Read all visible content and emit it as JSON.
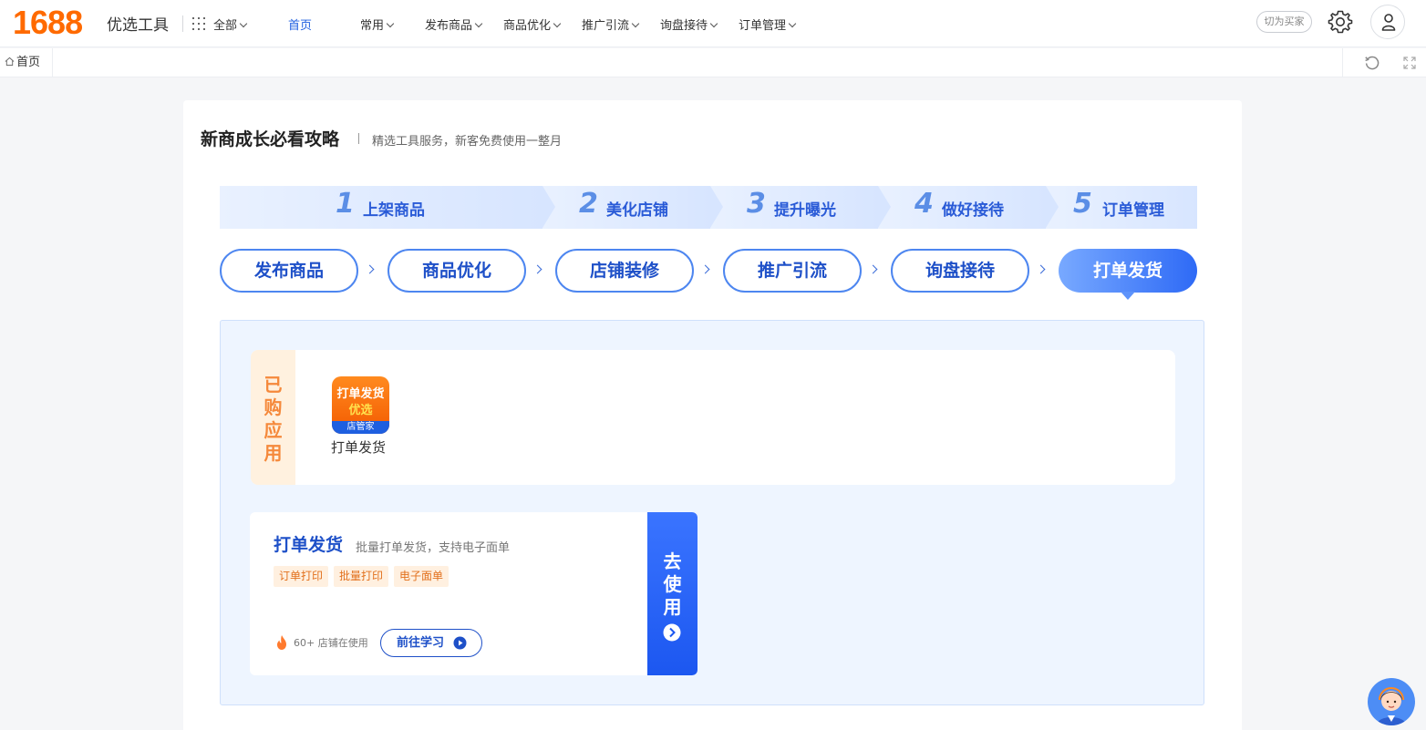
{
  "header": {
    "logo": "1688",
    "subtitle": "优选工具",
    "all_menu": "全部",
    "nav": [
      {
        "label": "首页",
        "active": true
      },
      {
        "label": "常用"
      },
      {
        "label": "发布商品"
      },
      {
        "label": "商品优化"
      },
      {
        "label": "推广引流"
      },
      {
        "label": "询盘接待"
      },
      {
        "label": "订单管理"
      }
    ],
    "switch_label": "切为买家",
    "icons": [
      "gear-icon",
      "user-icon"
    ]
  },
  "tabs": {
    "home_label": "首页",
    "icons": [
      "home-icon",
      "refresh-icon",
      "expand-icon"
    ]
  },
  "guide": {
    "title": "新商成长必看攻略",
    "desc": "精选工具服务，新客免费使用一整月",
    "steps": [
      {
        "num": "1",
        "label": "上架商品"
      },
      {
        "num": "2",
        "label": "美化店铺"
      },
      {
        "num": "3",
        "label": "提升曝光"
      },
      {
        "num": "4",
        "label": "做好接待"
      },
      {
        "num": "5",
        "label": "订单管理"
      }
    ],
    "pills": [
      {
        "label": "发布商品"
      },
      {
        "label": "商品优化"
      },
      {
        "label": "店铺装修"
      },
      {
        "label": "推广引流"
      },
      {
        "label": "询盘接待"
      },
      {
        "label": "打单发货",
        "active": true
      }
    ]
  },
  "bought": {
    "side_chars": [
      "已",
      "购",
      "应",
      "用"
    ],
    "app": {
      "icon_line1": "打单发货",
      "icon_line2": "优选",
      "icon_band": "店管家",
      "name": "打单发货"
    }
  },
  "tool": {
    "title": "打单发货",
    "desc": "批量打单发货，支持电子面单",
    "tags": [
      "订单打印",
      "批量打印",
      "电子面单"
    ],
    "usage": "60+ 店铺在使用",
    "learn_label": "前往学习",
    "use_chars": [
      "去",
      "使",
      "用"
    ]
  },
  "colors": {
    "brand": "#ff6a00",
    "primary": "#1e50c8",
    "accent_blue": "#2e6af6",
    "tag_text": "#e2701c",
    "bought_side": "#f5893b"
  }
}
